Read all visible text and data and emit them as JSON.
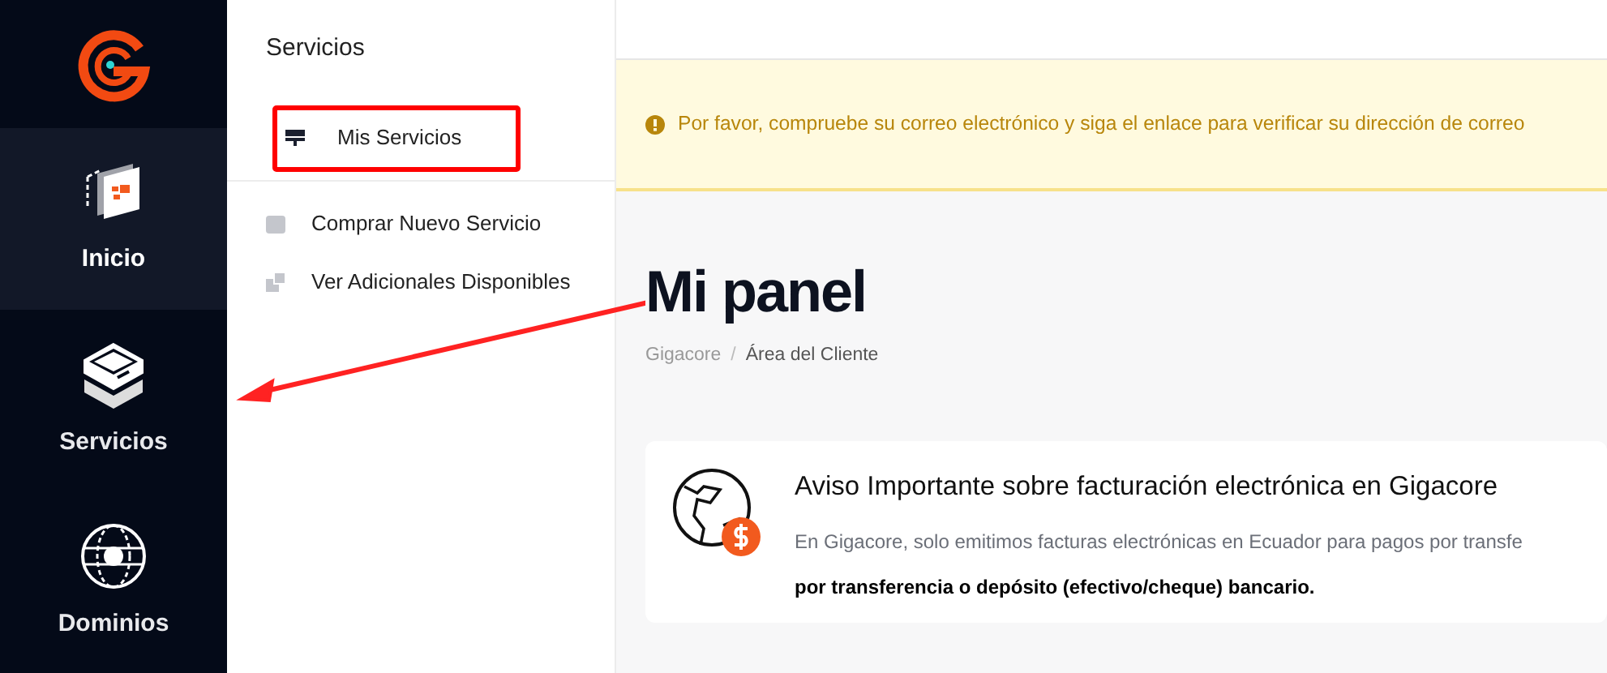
{
  "rail": [
    {
      "label": "Inicio",
      "kind": "inicio",
      "selected": true
    },
    {
      "label": "Servicios",
      "kind": "servicios",
      "selected": false
    },
    {
      "label": "Dominios",
      "kind": "dominios",
      "selected": false
    }
  ],
  "submenu": {
    "title": "Servicios",
    "items": [
      {
        "label": "Mis Servicios",
        "kind": "server",
        "selected": true
      },
      {
        "label": "Comprar Nuevo Servicio",
        "kind": "bag",
        "selected": false
      },
      {
        "label": "Ver Adicionales Disponibles",
        "kind": "addons",
        "selected": false
      }
    ]
  },
  "alert": {
    "text": "Por favor, compruebe su correo electrónico y siga el enlace para verificar su dirección de correo"
  },
  "page": {
    "title": "Mi panel",
    "breadcrumb": [
      "Gigacore",
      "Área del Cliente"
    ],
    "breadcrumb_separator": "/"
  },
  "notice": {
    "title": "Aviso Importante sobre facturación electrónica en Gigacore",
    "lines": [
      "En Gigacore, solo emitimos facturas electrónicas en Ecuador para pagos por transfe",
      "por transferencia o depósito (efectivo/cheque) bancario."
    ]
  }
}
